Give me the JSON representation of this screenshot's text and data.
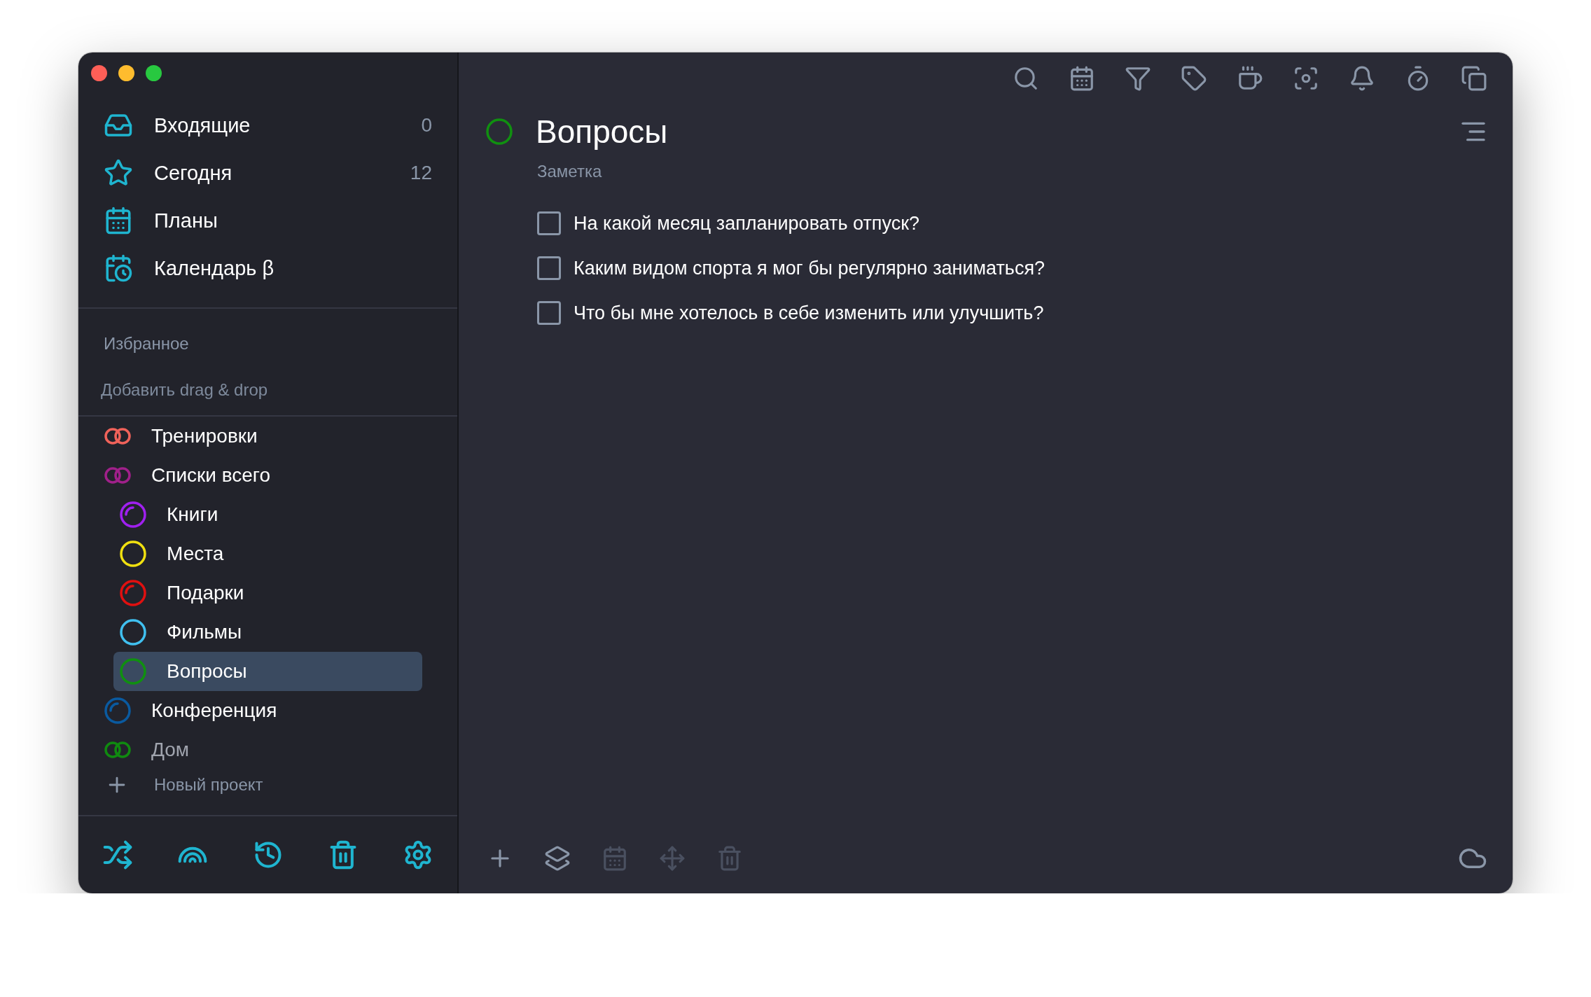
{
  "sidebar": {
    "nav": [
      {
        "label": "Входящие",
        "count": "0"
      },
      {
        "label": "Сегодня",
        "count": "12"
      },
      {
        "label": "Планы"
      },
      {
        "label": "Календарь β"
      }
    ],
    "favorites": {
      "title": "Избранное",
      "hint": "Добавить drag & drop"
    },
    "projects": [
      {
        "kind": "folder",
        "label": "Тренировки",
        "color": "#f0625a",
        "selected": false
      },
      {
        "kind": "folder",
        "label": "Списки всего",
        "color": "#a0208a",
        "selected": false,
        "children": [
          {
            "kind": "project",
            "label": "Книги",
            "color": "#a020f0",
            "in_progress": true,
            "selected": false
          },
          {
            "kind": "project",
            "label": "Места",
            "color": "#f0e010",
            "in_progress": false,
            "selected": false
          },
          {
            "kind": "project",
            "label": "Подарки",
            "color": "#e01010",
            "in_progress": true,
            "selected": false
          },
          {
            "kind": "project",
            "label": "Фильмы",
            "color": "#40c0f0",
            "in_progress": false,
            "selected": false
          },
          {
            "kind": "project",
            "label": "Вопросы",
            "color": "#109010",
            "in_progress": false,
            "selected": true
          }
        ]
      },
      {
        "kind": "project",
        "label": "Конференция",
        "color": "#0a5aa0",
        "in_progress": true,
        "selected": false
      },
      {
        "kind": "folder",
        "label": "Дом",
        "color": "#108a10",
        "selected": false
      }
    ],
    "new_project": "Новый проект"
  },
  "main": {
    "title": "Вопросы",
    "subtitle": "Заметка",
    "checklist": [
      {
        "text": "На какой месяц запланировать отпуск?",
        "checked": false
      },
      {
        "text": "Каким видом спорта я мог бы регулярно заниматься?",
        "checked": false
      },
      {
        "text": "Что бы мне хотелось в себе изменить или улучшить?",
        "checked": false
      }
    ],
    "bottom_toolbar": [
      {
        "disabled": false
      },
      {
        "disabled": false
      },
      {
        "disabled": true
      },
      {
        "disabled": true
      },
      {
        "disabled": true
      }
    ]
  }
}
